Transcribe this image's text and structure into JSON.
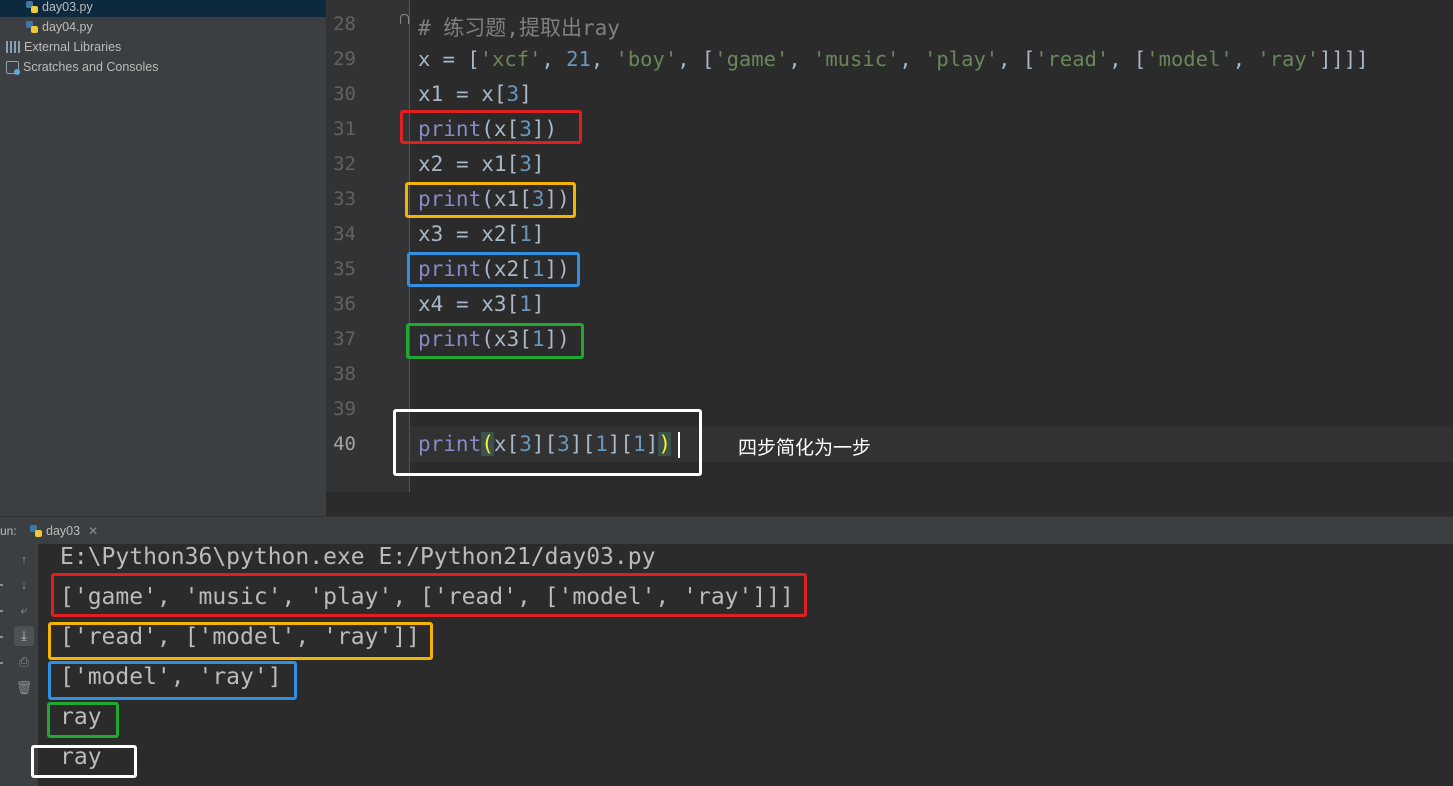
{
  "project": {
    "files": [
      {
        "name": "day03.py",
        "selected": true
      },
      {
        "name": "day04.py",
        "selected": false
      }
    ],
    "external_libraries": "External Libraries",
    "scratches": "Scratches and Consoles"
  },
  "editor": {
    "line_numbers": [
      "28",
      "29",
      "30",
      "31",
      "32",
      "33",
      "34",
      "35",
      "36",
      "37",
      "38",
      "39",
      "40"
    ],
    "lines": {
      "l28": "练习题,提取出ray",
      "l29_var": "x",
      "l29_items": [
        "'xcf'",
        "21",
        "'boy'",
        "'game'",
        "'music'",
        "'play'",
        "'read'",
        "'model'",
        "'ray'"
      ],
      "l30": {
        "var": "x1",
        "src": "x",
        "index": "3"
      },
      "l31": {
        "fn": "print",
        "arg": "x",
        "index": "3"
      },
      "l32": {
        "var": "x2",
        "src": "x1",
        "index": "3"
      },
      "l33": {
        "fn": "print",
        "arg": "x1",
        "index": "3"
      },
      "l34": {
        "var": "x3",
        "src": "x2",
        "index": "1"
      },
      "l35": {
        "fn": "print",
        "arg": "x2",
        "index": "1"
      },
      "l36": {
        "var": "x4",
        "src": "x3",
        "index": "1"
      },
      "l37": {
        "fn": "print",
        "arg": "x3",
        "index": "1"
      },
      "l40": {
        "fn": "print",
        "arg": "x",
        "indices": [
          "3",
          "3",
          "1",
          "1"
        ]
      }
    },
    "annotation": "四步简化为一步"
  },
  "run": {
    "label": "un:",
    "tab": "day03",
    "output": [
      "E:\\Python36\\python.exe E:/Python21/day03.py",
      "['game', 'music', 'play', ['read', ['model', 'ray']]]",
      "['read', ['model', 'ray']]",
      "['model', 'ray']",
      "ray",
      "ray"
    ]
  },
  "colors": {
    "box_red": "#e02020",
    "box_yellow": "#f4b400",
    "box_blue": "#2f8fe0",
    "box_green": "#20a830",
    "box_white": "#ffffff"
  }
}
